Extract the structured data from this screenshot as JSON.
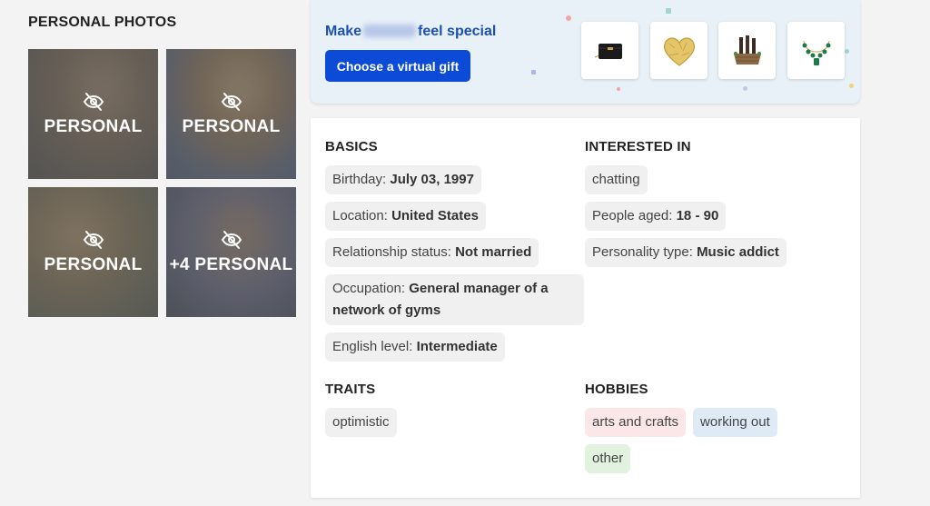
{
  "personal_photos": {
    "title": "PERSONAL PHOTOS",
    "photos": [
      {
        "label": "PERSONAL"
      },
      {
        "label": "PERSONAL"
      },
      {
        "label": "PERSONAL"
      },
      {
        "label": "+4 PERSONAL"
      }
    ]
  },
  "gift_banner": {
    "heading_before": "Make",
    "heading_after": "feel special",
    "button_label": "Choose a virtual gift",
    "gifts": [
      "handbag-icon",
      "golden-heart-icon",
      "wine-basket-icon",
      "emerald-necklace-icon"
    ]
  },
  "basics": {
    "title": "BASICS",
    "items": [
      {
        "label": "Birthday:",
        "value": "July 03, 1997"
      },
      {
        "label": "Location:",
        "value": "United States"
      },
      {
        "label": "Relationship status:",
        "value": "Not married"
      },
      {
        "label": "Occupation:",
        "value": "General manager of a network of gyms"
      },
      {
        "label": "English level:",
        "value": "Intermediate"
      }
    ]
  },
  "interested_in": {
    "title": "INTERESTED IN",
    "chatting": "chatting",
    "people_aged_label": "People aged:",
    "people_aged_value": "18 - 90",
    "personality_label": "Personality type:",
    "personality_value": "Music addict"
  },
  "traits": {
    "title": "TRAITS",
    "items": [
      "optimistic"
    ]
  },
  "hobbies": {
    "title": "HOBBIES",
    "items": [
      "arts and crafts",
      "working out",
      "other"
    ]
  },
  "colors": {
    "accent": "#0b4bd6",
    "heading_blue": "#1b4fb5",
    "banner_bg": "#e8f1f8",
    "chip_pink": "#fbe7e7",
    "chip_blue": "#dfeaf7",
    "chip_green": "#e1f2df"
  }
}
